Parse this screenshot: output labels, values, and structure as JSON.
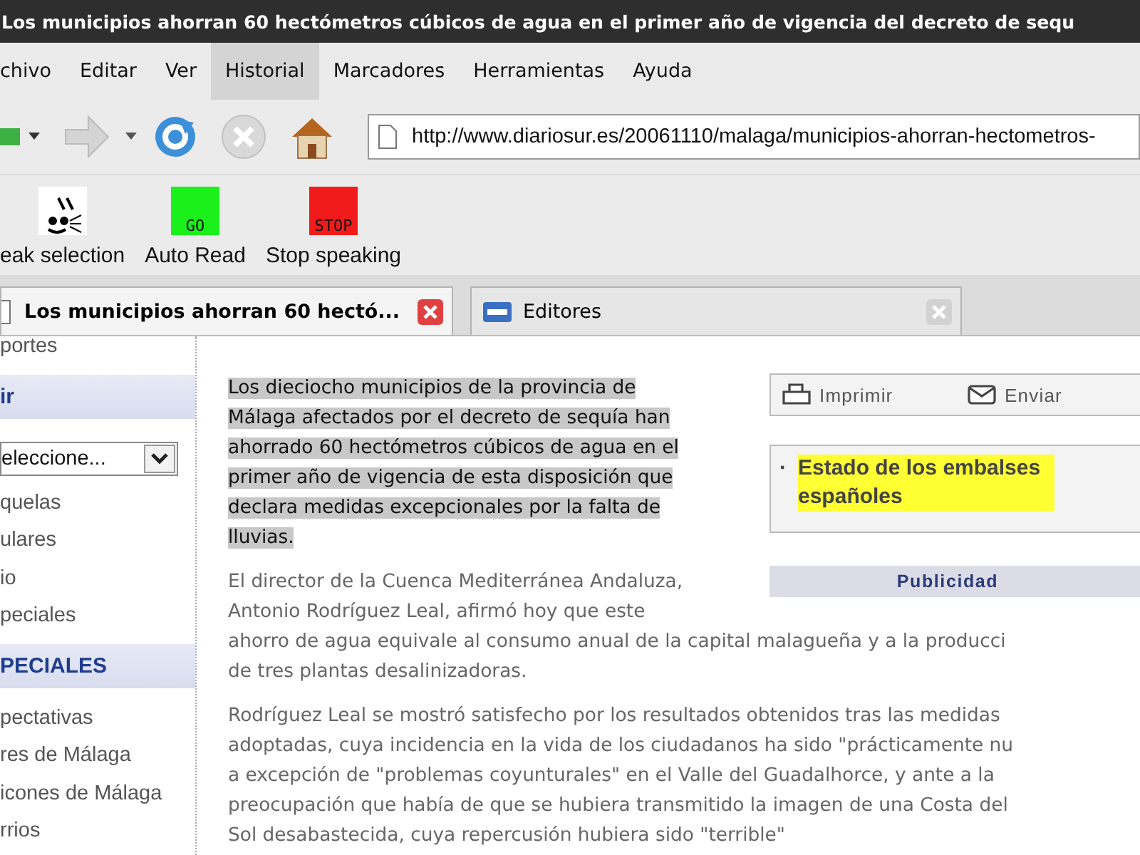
{
  "window": {
    "title": "Los municipios ahorran 60 hectómetros cúbicos de agua en el primer año de vigencia del decreto de sequ"
  },
  "menu": [
    {
      "label": "chivo",
      "selected": false
    },
    {
      "label": "Editar",
      "selected": false
    },
    {
      "label": "Ver",
      "selected": false
    },
    {
      "label": "Historial",
      "selected": true
    },
    {
      "label": "Marcadores",
      "selected": false
    },
    {
      "label": "Herramientas",
      "selected": false
    },
    {
      "label": "Ayuda",
      "selected": false
    }
  ],
  "nav_toolbar": {
    "url": "http://www.diariosur.es/20061110/malaga/municipios-ahorran-hectometros-"
  },
  "speech_toolbar": [
    {
      "kind": "speak",
      "label": "eak selection"
    },
    {
      "kind": "go",
      "label": "Auto Read",
      "icon_text": "GO"
    },
    {
      "kind": "stop",
      "label": "Stop speaking",
      "icon_text": "STOP"
    }
  ],
  "tabs": [
    {
      "label": "Los municipios ahorran 60 hectó...",
      "selected": true
    },
    {
      "label": "Editores",
      "selected": false
    }
  ],
  "sidebar": {
    "items": [
      {
        "kind": "link",
        "label": "portes"
      },
      {
        "kind": "header",
        "label": "ir"
      },
      {
        "kind": "select",
        "value": "eleccione..."
      },
      {
        "kind": "link",
        "label": "quelas"
      },
      {
        "kind": "link",
        "label": "ulares"
      },
      {
        "kind": "link",
        "label": "io"
      },
      {
        "kind": "link",
        "label": "peciales"
      },
      {
        "kind": "header",
        "label": "PECIALES"
      },
      {
        "kind": "link",
        "label": "pectativas"
      },
      {
        "kind": "link",
        "label": "res de Málaga"
      },
      {
        "kind": "link",
        "label": "icones de Málaga"
      },
      {
        "kind": "link",
        "label": "rrios"
      }
    ]
  },
  "article": {
    "paragraphs": [
      {
        "highlighted": true,
        "lines": [
          "Los dieciocho municipios de la provincia de",
          "Málaga afectados por el decreto de sequía han",
          "ahorrado 60 hectómetros cúbicos de agua en el",
          "primer año de vigencia de esta disposición que",
          "declara medidas excepcionales por la falta de",
          "lluvias."
        ]
      },
      {
        "highlighted": false,
        "lines": [
          "El director de la Cuenca Mediterránea Andaluza,",
          "Antonio Rodríguez Leal, afirmó hoy que este",
          "ahorro de agua equivale al consumo anual de la capital malagueña y a la producci",
          "de tres plantas desalinizadoras."
        ]
      },
      {
        "highlighted": false,
        "lines": [
          "Rodríguez Leal se mostró satisfecho por los resultados obtenidos tras las medidas",
          "adoptadas, cuya incidencia en la vida de los ciudadanos ha sido \"prácticamente nu",
          "a excepción de \"problemas coyunturales\" en el Valle del Guadalhorce, y ante a la",
          "preocupación que había de que se hubiera transmitido la imagen de una Costa del",
          "Sol desabastecida, cuya repercusión hubiera sido \"terrible\""
        ]
      }
    ]
  },
  "tools": [
    {
      "kind": "print",
      "label": "Imprimir"
    },
    {
      "kind": "mail",
      "label": "Enviar"
    }
  ],
  "related_link": {
    "bullet": "·",
    "label": "Estado de los embalses españoles",
    "highlighted": true
  },
  "ad_label": "Publicidad"
}
